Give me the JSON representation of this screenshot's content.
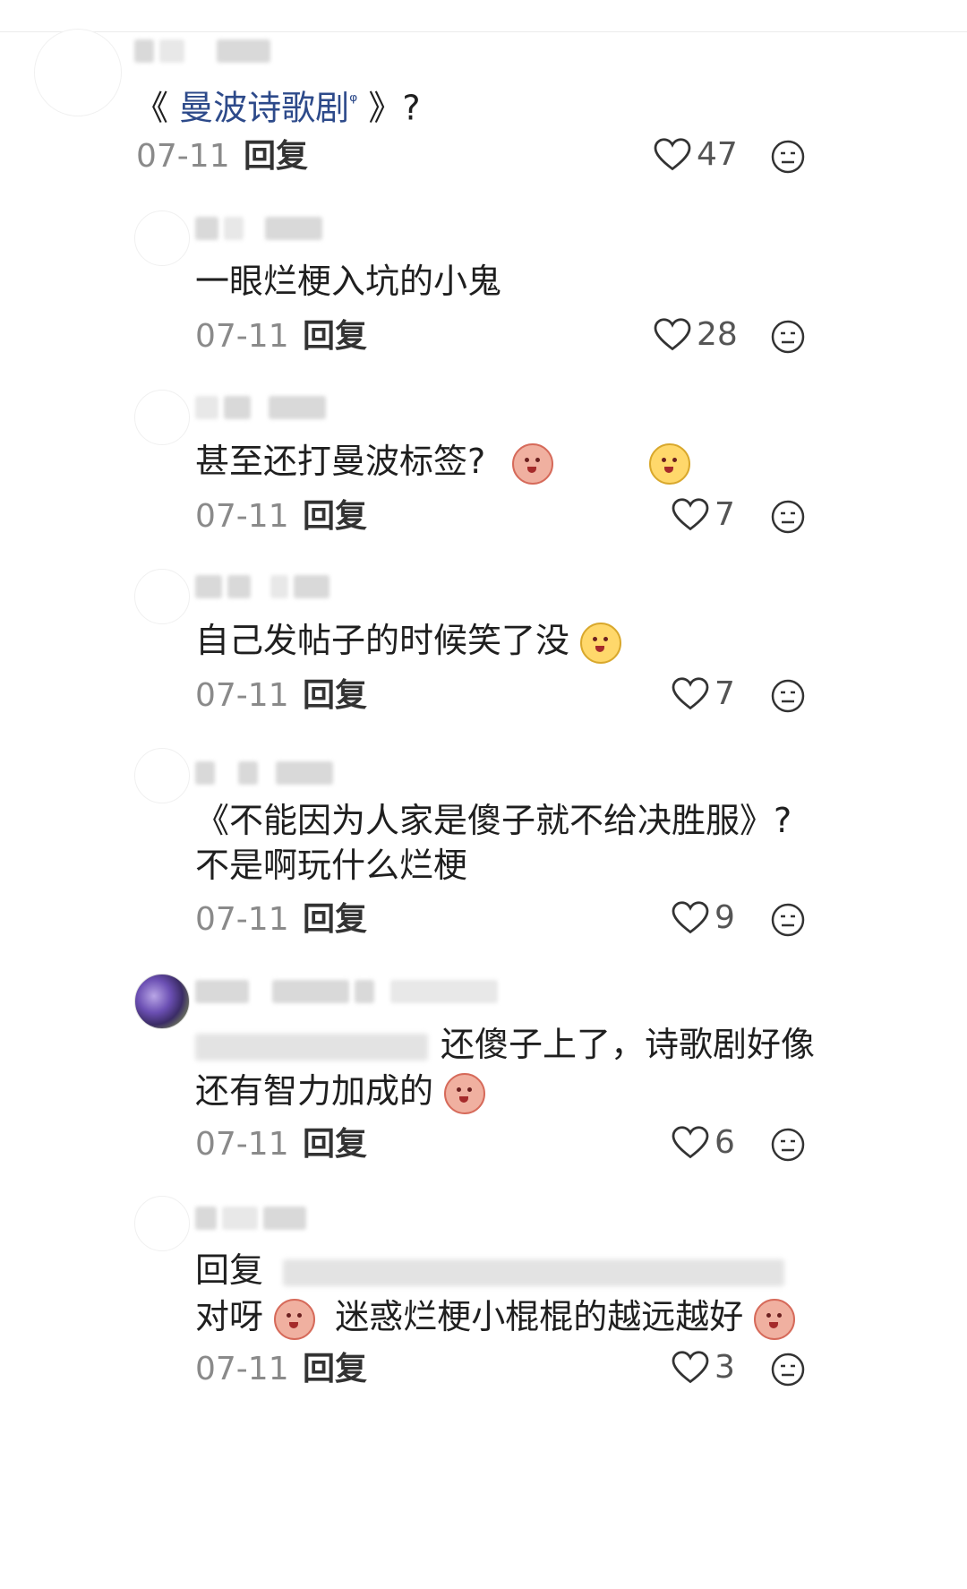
{
  "comments": [
    {
      "text_main": "曼波诗歌剧",
      "text_prefix": "《 ",
      "text_search_icon": "ᵠ",
      "text_suffix": " 》?",
      "date": "07-11",
      "reply": "回复",
      "likes": "47"
    },
    {
      "text": "一眼烂梗入坑的小鬼",
      "date": "07-11",
      "reply": "回复",
      "likes": "28"
    },
    {
      "text": "甚至还打曼波标签?",
      "date": "07-11",
      "reply": "回复",
      "likes": "7"
    },
    {
      "text": "自己发帖子的时候笑了没",
      "date": "07-11",
      "reply": "回复",
      "likes": "7"
    },
    {
      "text_line1": "《不能因为人家是傻子就不给决胜服》?",
      "text_line2": "不是啊玩什么烂梗",
      "date": "07-11",
      "reply": "回复",
      "likes": "9"
    },
    {
      "text_line1": "还傻子上了，诗歌剧好像",
      "text_line2": "还有智力加成的",
      "date": "07-11",
      "reply": "回复",
      "likes": "6"
    },
    {
      "reply_prefix": "回复",
      "text_line2a": "对呀",
      "text_line2b": "迷惑烂梗小棍棍的越远越好",
      "date": "07-11",
      "reply": "回复",
      "likes": "3"
    }
  ],
  "icons": {
    "like": "heart-outline-icon",
    "more": "emoji-reaction-icon",
    "emoji_pink": "pink-bean-emoji",
    "emoji_yellow": "yellow-bean-emoji"
  }
}
